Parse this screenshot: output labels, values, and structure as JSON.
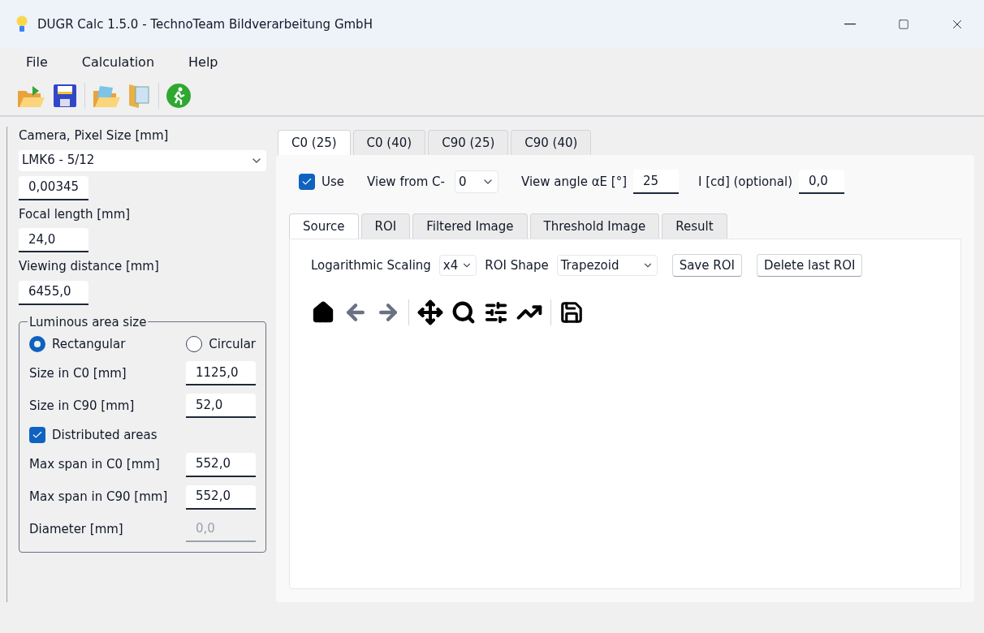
{
  "window": {
    "title": "DUGR Calc 1.5.0 - TechnoTeam Bildverarbeitung GmbH"
  },
  "menu": [
    "File",
    "Calculation",
    "Help"
  ],
  "camera": {
    "label": "Camera, Pixel Size [mm]",
    "selection": "LMK6 - 5/12",
    "pixel_size": "0,00345"
  },
  "focal": {
    "label": "Focal length [mm]",
    "value": "24,0"
  },
  "distance": {
    "label": "Viewing distance [mm]",
    "value": "6455,0"
  },
  "area": {
    "title": "Luminous area size",
    "shapes": [
      {
        "label": "Rectangular",
        "selected": true
      },
      {
        "label": "Circular",
        "selected": false
      }
    ],
    "rows": [
      {
        "kind": "field",
        "label": "Size in C0 [mm]",
        "value": "1125,0",
        "disabled": false
      },
      {
        "kind": "field",
        "label": "Size in C90 [mm]",
        "value": "52,0",
        "disabled": false
      },
      {
        "kind": "checkbox",
        "label": "Distributed areas",
        "checked": true
      },
      {
        "kind": "field",
        "label": "Max span in C0 [mm]",
        "value": "552,0",
        "disabled": false
      },
      {
        "kind": "field",
        "label": "Max span in C90 [mm]",
        "value": "552,0",
        "disabled": false
      },
      {
        "kind": "field",
        "label": "Diameter [mm]",
        "value": "0,0",
        "disabled": true
      }
    ]
  },
  "tabs": [
    {
      "label": "C0 (25)",
      "selected": true
    },
    {
      "label": "C0 (40)",
      "selected": false
    },
    {
      "label": "C90 (25)",
      "selected": false
    },
    {
      "label": "C90 (40)",
      "selected": false
    }
  ],
  "options": {
    "use": {
      "label": "Use",
      "checked": true
    },
    "view_from": {
      "label": "View from C-",
      "value": "0"
    },
    "angle": {
      "label": "View angle αE [°]",
      "value": "25"
    },
    "intensity": {
      "label": "I [cd] (optional)",
      "value": "0,0"
    }
  },
  "subtabs": [
    {
      "label": "Source",
      "selected": true
    },
    {
      "label": "ROI",
      "selected": false
    },
    {
      "label": "Filtered Image",
      "selected": false
    },
    {
      "label": "Threshold Image",
      "selected": false
    },
    {
      "label": "Result",
      "selected": false
    }
  ],
  "source": {
    "scaling_label": "Logarithmic Scaling",
    "scaling": "x4",
    "shape_label": "ROI Shape",
    "shape": "Trapezoid",
    "buttons": [
      "Save ROI",
      "Delete last ROI"
    ]
  }
}
